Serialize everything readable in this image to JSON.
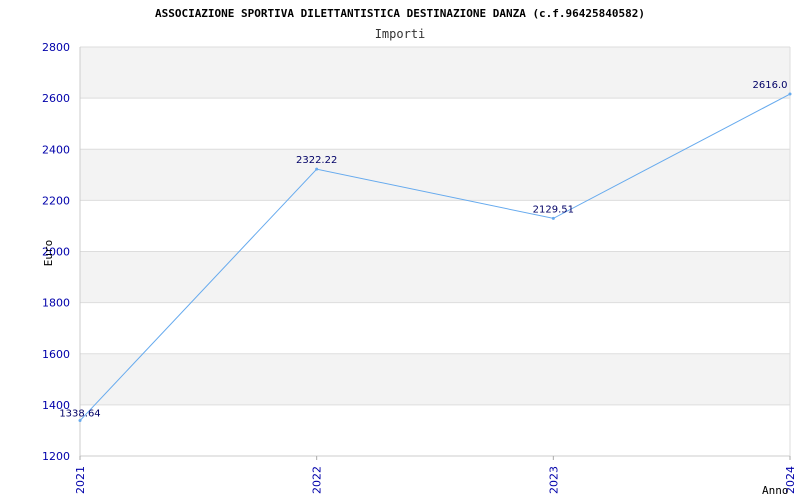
{
  "chart_data": {
    "type": "line",
    "title": "ASSOCIAZIONE SPORTIVA DILETTANTISTICA DESTINAZIONE DANZA (c.f.96425840582)",
    "subtitle": "Importi",
    "xlabel": "Anno",
    "ylabel": "Euro",
    "categories": [
      "2021",
      "2022",
      "2023",
      "2024"
    ],
    "values": [
      1338.64,
      2322.22,
      2129.51,
      2616.0
    ],
    "data_labels": [
      "1338.64",
      "2322.22",
      "2129.51",
      "2616.0"
    ],
    "ylim": [
      1200,
      2800
    ],
    "yticks": [
      "1200",
      "1400",
      "1600",
      "1800",
      "2000",
      "2200",
      "2400",
      "2600",
      "2800"
    ],
    "grid": true,
    "colors": {
      "line": "#66aaee",
      "band": "#f3f3f3",
      "gridline": "#dddddd",
      "tick_text": "#0000aa",
      "title_text": "#000000",
      "data_label_text": "#000066"
    }
  }
}
